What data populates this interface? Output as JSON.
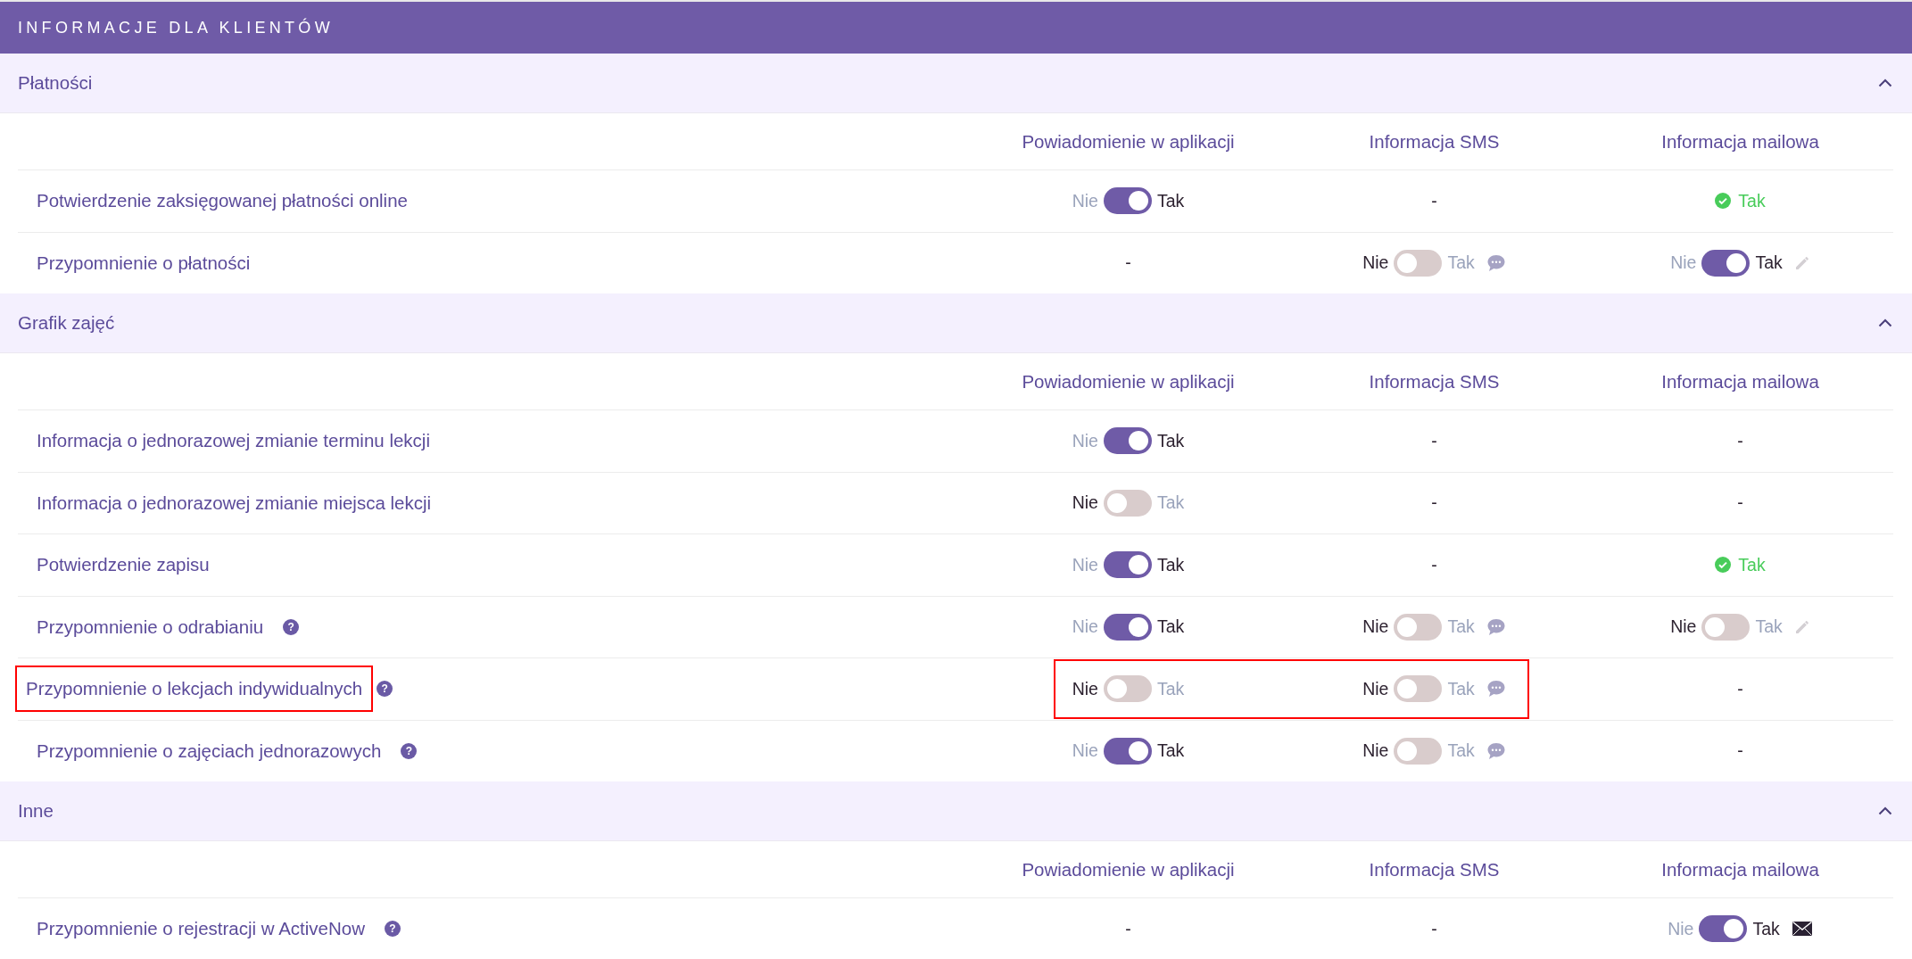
{
  "title": "INFORMACJE DLA KLIENTÓW",
  "sections": [
    {
      "title": "Płatności",
      "expanded": true,
      "columns": [
        "Powiadomienie w aplikacji",
        "Informacja SMS",
        "Informacja mailowa"
      ],
      "rows": [
        {
          "label": "Potwierdzenie zaksięgowanej płatności online",
          "highlighted": false,
          "cells": [
            {
              "kind": "toggle",
              "off_label": "Nie",
              "on_label": "Tak",
              "on": true,
              "highlighted": false
            },
            {
              "kind": "dash",
              "text": "-",
              "highlighted": false
            },
            {
              "kind": "status",
              "text": "Tak",
              "highlighted": false
            }
          ]
        },
        {
          "label": "Przypomnienie o płatności",
          "highlighted": false,
          "cells": [
            {
              "kind": "dash",
              "text": "-",
              "highlighted": false
            },
            {
              "kind": "smstoggle",
              "off_label": "Nie",
              "on_label": "Tak",
              "on": false,
              "highlighted": false
            },
            {
              "kind": "edittoggle",
              "off_label": "Nie",
              "on_label": "Tak",
              "on": true,
              "highlighted": false
            }
          ]
        }
      ]
    },
    {
      "title": "Grafik zajęć",
      "expanded": true,
      "columns": [
        "Powiadomienie w aplikacji",
        "Informacja SMS",
        "Informacja mailowa"
      ],
      "rows": [
        {
          "label": "Informacja o jednorazowej zmianie terminu lekcji",
          "highlighted": false,
          "cells": [
            {
              "kind": "toggle",
              "off_label": "Nie",
              "on_label": "Tak",
              "on": true,
              "highlighted": false
            },
            {
              "kind": "dash",
              "text": "-",
              "highlighted": false
            },
            {
              "kind": "dash",
              "text": "-",
              "highlighted": false
            }
          ]
        },
        {
          "label": "Informacja o jednorazowej zmianie miejsca lekcji",
          "highlighted": false,
          "cells": [
            {
              "kind": "toggle",
              "off_label": "Nie",
              "on_label": "Tak",
              "on": false,
              "highlighted": false
            },
            {
              "kind": "dash",
              "text": "-",
              "highlighted": false
            },
            {
              "kind": "dash",
              "text": "-",
              "highlighted": false
            }
          ]
        },
        {
          "label": "Potwierdzenie zapisu",
          "highlighted": false,
          "cells": [
            {
              "kind": "toggle",
              "off_label": "Nie",
              "on_label": "Tak",
              "on": true,
              "highlighted": false
            },
            {
              "kind": "dash",
              "text": "-",
              "highlighted": false
            },
            {
              "kind": "status",
              "text": "Tak",
              "highlighted": false
            }
          ]
        },
        {
          "label": "Przypomnienie o odrabianiu",
          "help": "?",
          "highlighted": false,
          "cells": [
            {
              "kind": "toggle",
              "off_label": "Nie",
              "on_label": "Tak",
              "on": true,
              "highlighted": false
            },
            {
              "kind": "smstoggle",
              "off_label": "Nie",
              "on_label": "Tak",
              "on": false,
              "highlighted": false
            },
            {
              "kind": "edittoggle",
              "off_label": "Nie",
              "on_label": "Tak",
              "on": false,
              "highlighted": false
            }
          ]
        },
        {
          "label": "Przypomnienie o lekcjach indywidualnych",
          "help": "?",
          "highlighted": true,
          "cells": [
            {
              "kind": "toggle",
              "off_label": "Nie",
              "on_label": "Tak",
              "on": false,
              "highlighted": true
            },
            {
              "kind": "smstoggle",
              "off_label": "Nie",
              "on_label": "Tak",
              "on": false,
              "highlighted": true
            },
            {
              "kind": "dash",
              "text": "-",
              "highlighted": false
            }
          ]
        },
        {
          "label": "Przypomnienie o zajęciach jednorazowych",
          "help": "?",
          "highlighted": false,
          "cells": [
            {
              "kind": "toggle",
              "off_label": "Nie",
              "on_label": "Tak",
              "on": true,
              "highlighted": false
            },
            {
              "kind": "smstoggle",
              "off_label": "Nie",
              "on_label": "Tak",
              "on": false,
              "highlighted": false
            },
            {
              "kind": "dash",
              "text": "-",
              "highlighted": false
            }
          ]
        }
      ]
    },
    {
      "title": "Inne",
      "expanded": true,
      "columns": [
        "Powiadomienie w aplikacji",
        "Informacja SMS",
        "Informacja mailowa"
      ],
      "rows": [
        {
          "label": "Przypomnienie o rejestracji w ActiveNow",
          "help": "?",
          "highlighted": false,
          "cells": [
            {
              "kind": "dash",
              "text": "-",
              "highlighted": false
            },
            {
              "kind": "dash",
              "text": "-",
              "highlighted": false
            },
            {
              "kind": "mailtoggle",
              "off_label": "Nie",
              "on_label": "Tak",
              "on": true,
              "highlighted": false
            }
          ]
        }
      ]
    }
  ]
}
